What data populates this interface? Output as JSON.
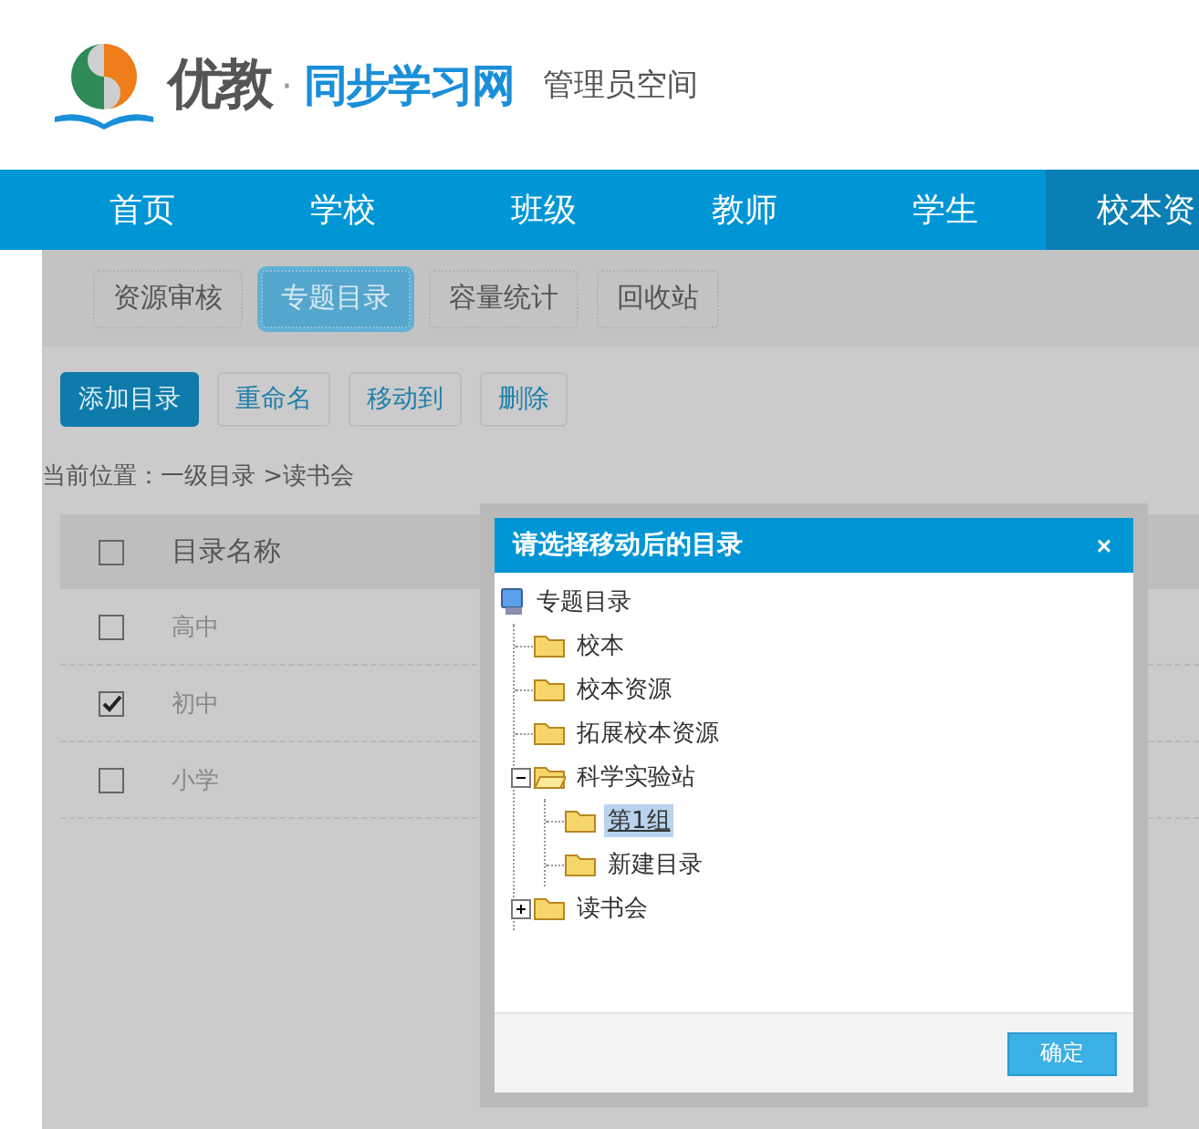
{
  "header": {
    "logo": {
      "name": "优教",
      "separator": "·",
      "brand": "同步学习网"
    },
    "subtitle": "管理员空间"
  },
  "nav": [
    {
      "label": "首页",
      "selected": false
    },
    {
      "label": "学校",
      "selected": false
    },
    {
      "label": "班级",
      "selected": false
    },
    {
      "label": "教师",
      "selected": false
    },
    {
      "label": "学生",
      "selected": false
    },
    {
      "label": "校本资",
      "selected": true
    }
  ],
  "subtabs": [
    {
      "label": "资源审核",
      "selected": false
    },
    {
      "label": "专题目录",
      "selected": true
    },
    {
      "label": "容量统计",
      "selected": false
    },
    {
      "label": "回收站",
      "selected": false
    }
  ],
  "actions": [
    {
      "label": "添加目录",
      "kind": "primary"
    },
    {
      "label": "重命名",
      "kind": "plain"
    },
    {
      "label": "移动到",
      "kind": "plain"
    },
    {
      "label": "删除",
      "kind": "plain"
    }
  ],
  "breadcrumb": "当前位置：一级目录 >读书会",
  "table": {
    "header": {
      "label": "目录名称",
      "checked": false
    },
    "rows": [
      {
        "name": "高中",
        "checked": false
      },
      {
        "name": "初中",
        "checked": true
      },
      {
        "name": "小学",
        "checked": false
      }
    ]
  },
  "dialog": {
    "title": "请选择移动后的目录",
    "close": "×",
    "root": "专题目录",
    "tree": [
      {
        "label": "校本",
        "selected": false
      },
      {
        "label": "校本资源",
        "selected": false
      },
      {
        "label": "拓展校本资源",
        "selected": false
      },
      {
        "label": "科学实验站",
        "selected": false,
        "expanded": true,
        "children": [
          {
            "label": "第1组",
            "selected": true
          },
          {
            "label": "新建目录",
            "selected": false
          }
        ]
      },
      {
        "label": "读书会",
        "selected": false,
        "expanded": false
      }
    ],
    "ok": "确定"
  }
}
